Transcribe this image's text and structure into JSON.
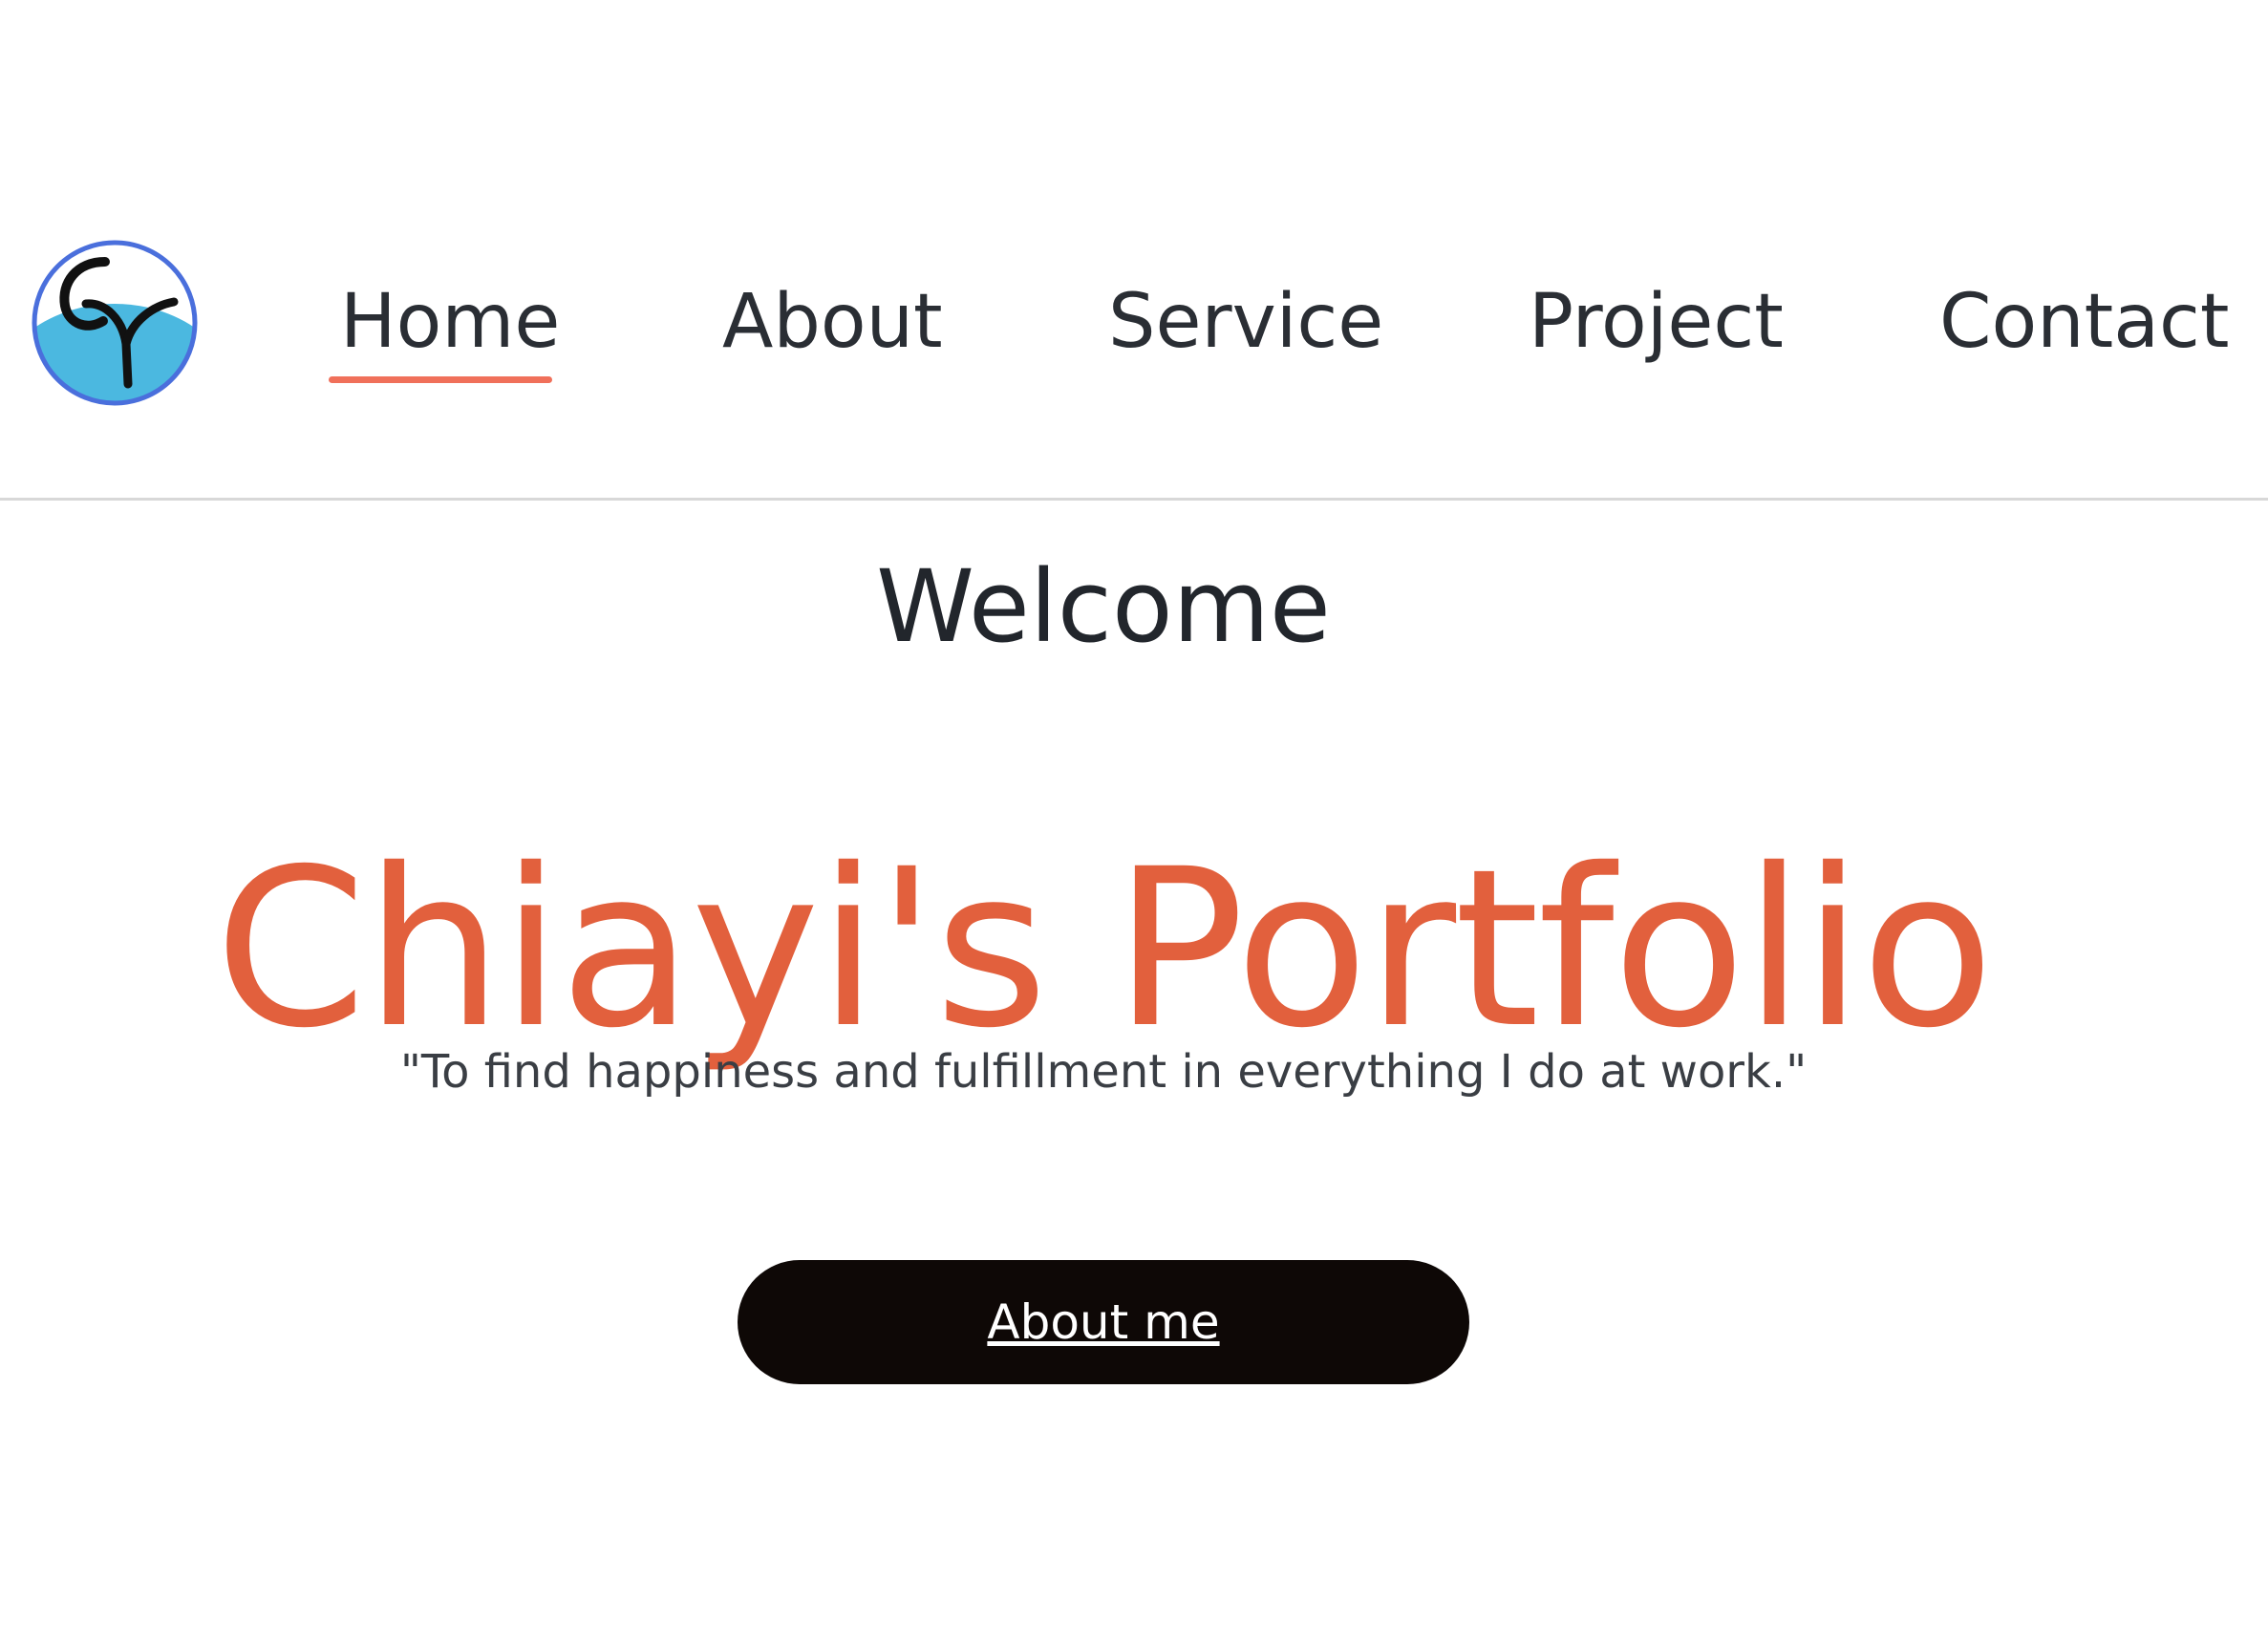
{
  "header": {
    "logo": {
      "icon": "cy-monogram-logo-icon",
      "ring_color": "#4a6fdc",
      "fill_color": "#4bb8e0",
      "letter_color": "#111111"
    },
    "nav": [
      {
        "label": "Home",
        "active": true
      },
      {
        "label": "About",
        "active": false
      },
      {
        "label": "Service",
        "active": false
      },
      {
        "label": "Project",
        "active": false
      },
      {
        "label": "Contact",
        "active": false
      }
    ],
    "active_underline_color": "#f0705a"
  },
  "hero": {
    "welcome": "Welcome",
    "title": "Chiayi's Portfolio",
    "title_color": "#e2603d",
    "quote": "\"To find happiness and fulfillment in everything I do at work.\"",
    "button_label": "About me",
    "button_color": "#0e0806"
  }
}
